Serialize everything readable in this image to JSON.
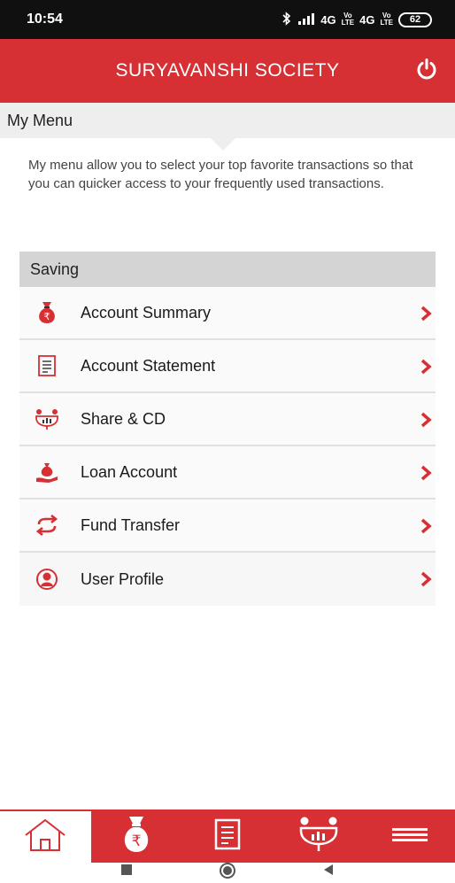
{
  "status_bar": {
    "time": "10:54",
    "network": "4G",
    "network2": "4G",
    "battery": "62"
  },
  "header": {
    "title": "SURYAVANSHI SOCIETY"
  },
  "menu": {
    "title": "My Menu",
    "description": "My menu allow you to select your top favorite transactions so that you can quicker access to your frequently used transactions."
  },
  "section": {
    "title": "Saving",
    "items": [
      {
        "label": "Account Summary",
        "icon": "money-bag-icon"
      },
      {
        "label": "Account Statement",
        "icon": "statement-icon"
      },
      {
        "label": "Share & CD",
        "icon": "share-chart-icon"
      },
      {
        "label": "Loan Account",
        "icon": "loan-hand-icon"
      },
      {
        "label": "Fund Transfer",
        "icon": "transfer-arrows-icon"
      },
      {
        "label": "User Profile",
        "icon": "user-profile-icon"
      }
    ]
  },
  "bottom_nav": {
    "tabs": [
      "home-icon",
      "money-bag-icon",
      "statement-icon",
      "share-chart-icon",
      "menu-bars-icon"
    ],
    "active_index": 0
  },
  "colors": {
    "brand": "#d63035",
    "section_bg": "#d4d4d4",
    "menu_header_bg": "#eeeeee"
  }
}
